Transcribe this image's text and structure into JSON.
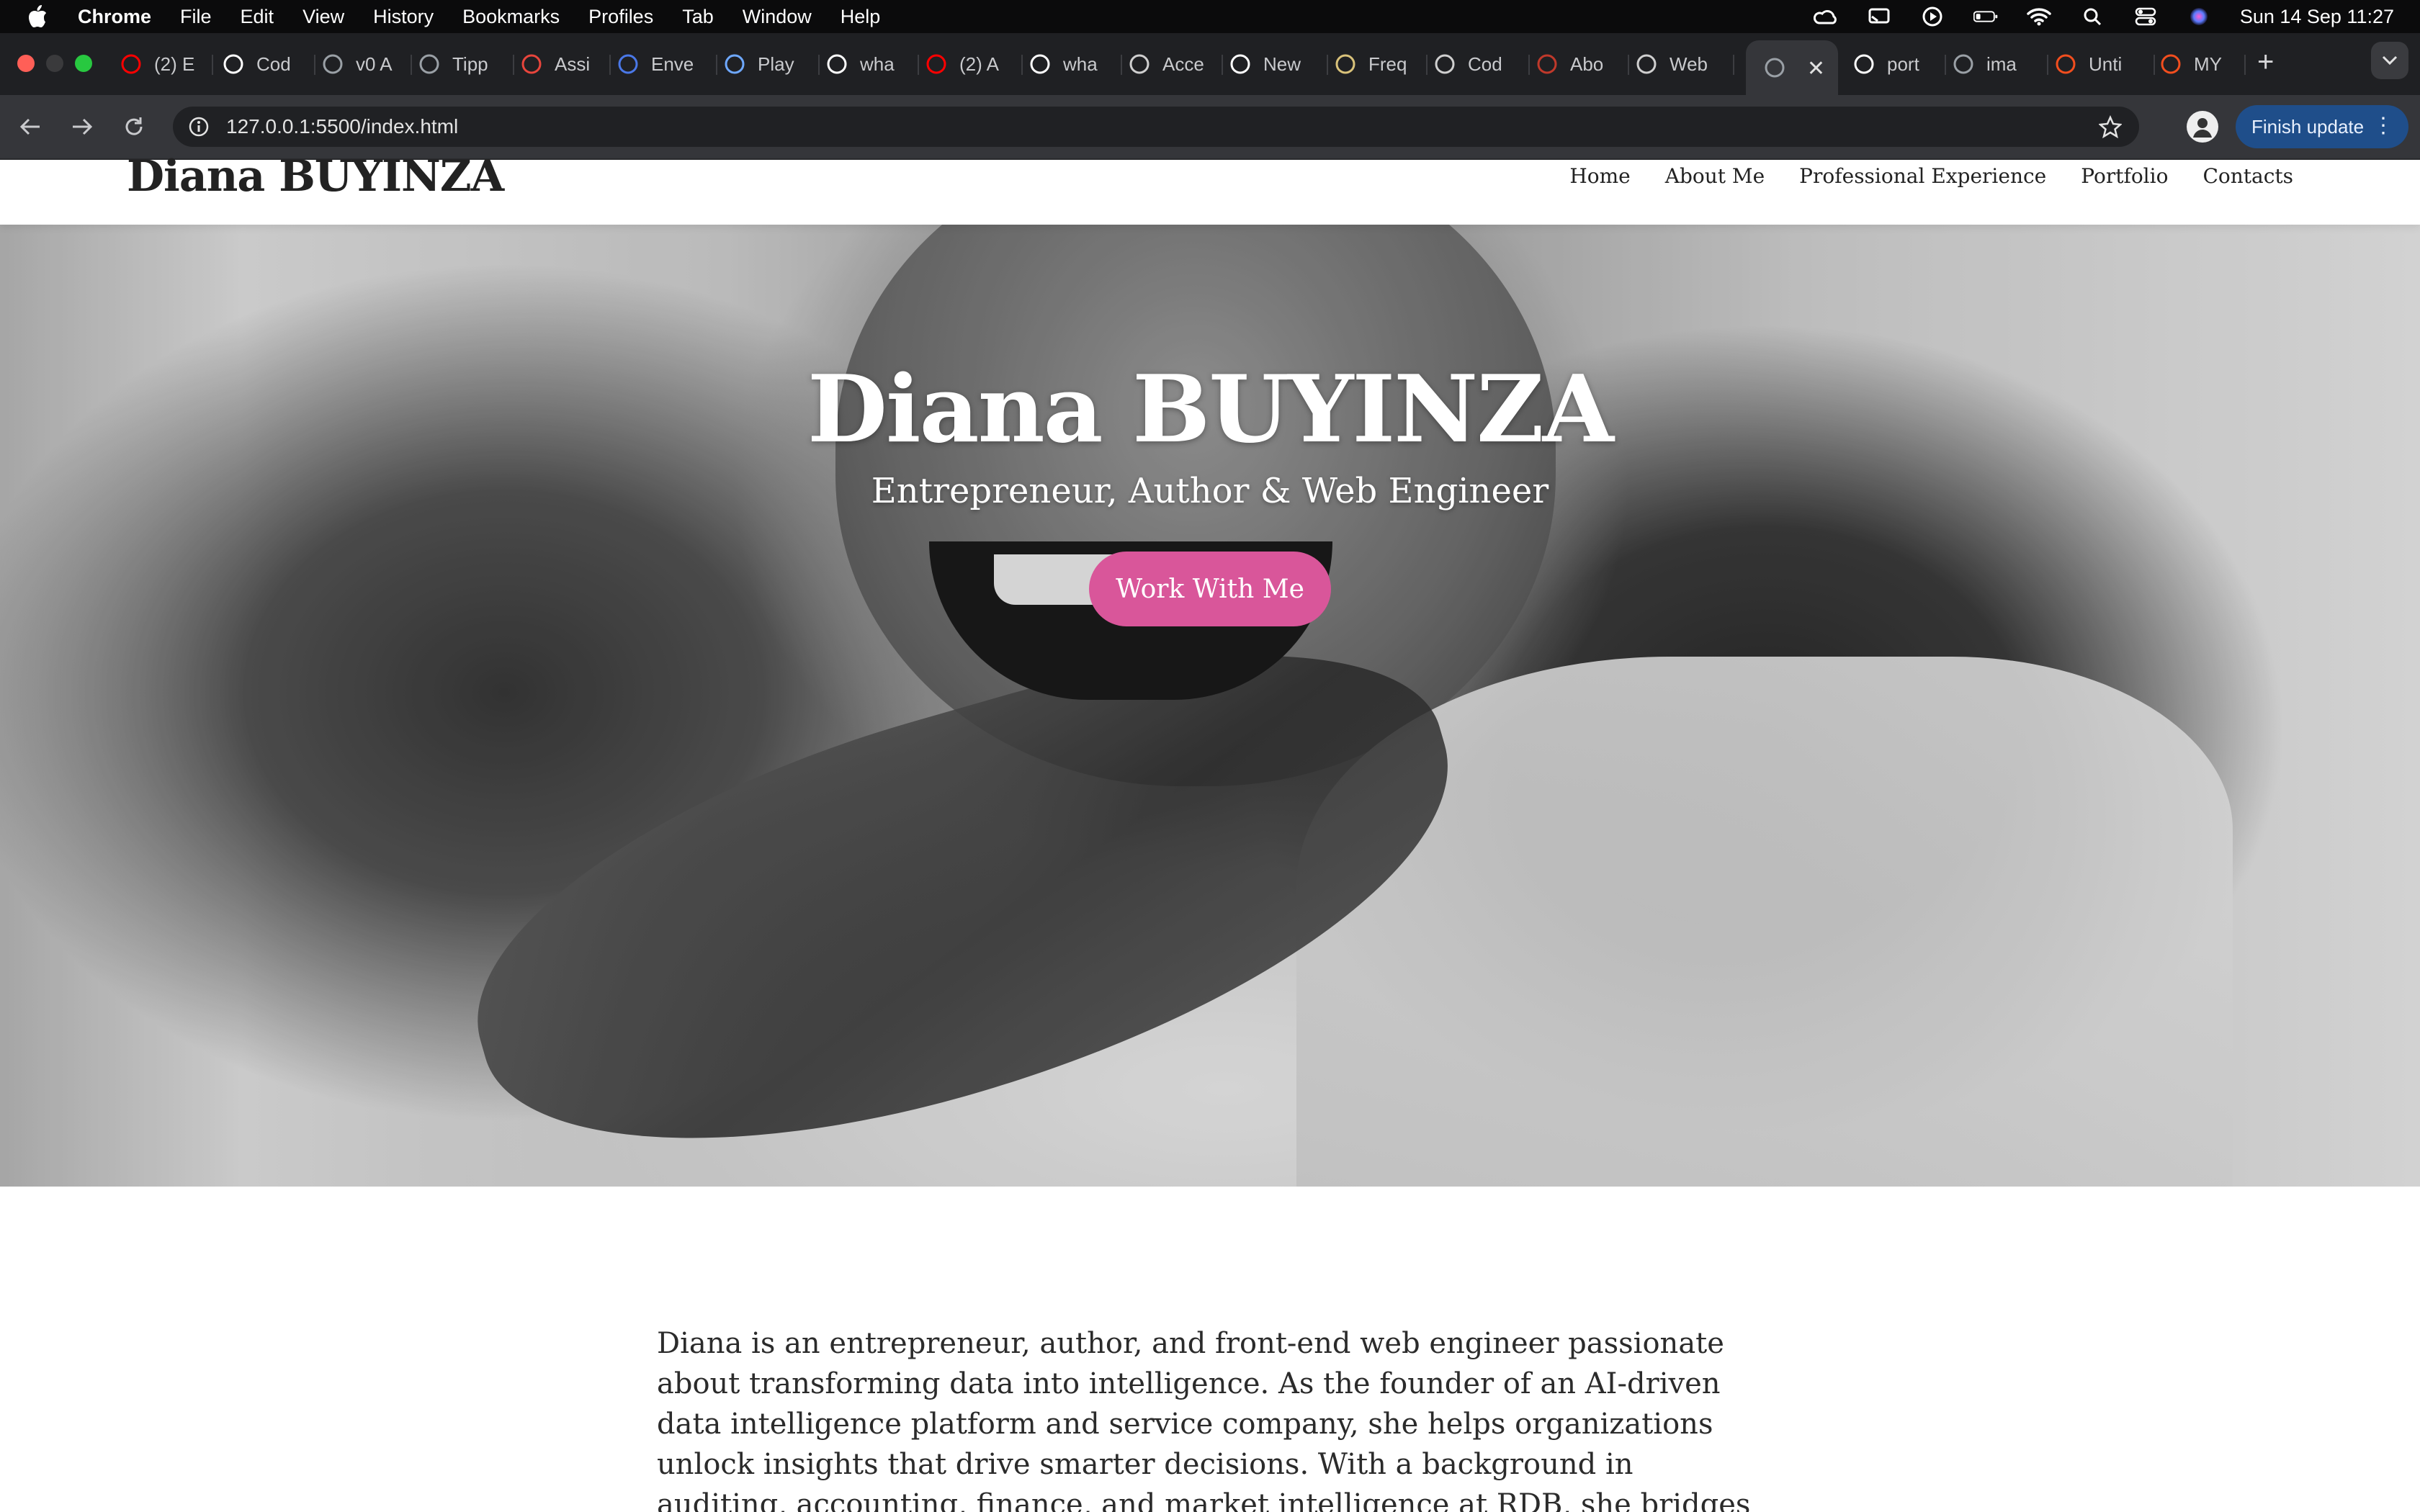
{
  "menubar": {
    "app_name": "Chrome",
    "items": [
      "File",
      "Edit",
      "View",
      "History",
      "Bookmarks",
      "Profiles",
      "Tab",
      "Window",
      "Help"
    ],
    "clock": "Sun 14 Sep  11:27"
  },
  "tabs": [
    {
      "label": "(2) E",
      "icon": "youtube-icon",
      "color": "#ff0000"
    },
    {
      "label": "Cod",
      "icon": "codepen-icon",
      "color": "#ffffff"
    },
    {
      "label": "v0 A",
      "icon": "globe-icon",
      "color": "#9aa0a6"
    },
    {
      "label": "Tipp",
      "icon": "tipp-icon",
      "color": "#9aa0a6"
    },
    {
      "label": "Assi",
      "icon": "assistant-icon",
      "color": "#e8453c"
    },
    {
      "label": "Enve",
      "icon": "flag-icon",
      "color": "#4a78e8"
    },
    {
      "label": "Play",
      "icon": "play-icon",
      "color": "#6ea8ff"
    },
    {
      "label": "wha",
      "icon": "google-icon",
      "color": "#ffffff"
    },
    {
      "label": "(2) A",
      "icon": "youtube-icon",
      "color": "#ff0000"
    },
    {
      "label": "wha",
      "icon": "google-icon",
      "color": "#ffffff"
    },
    {
      "label": "Acce",
      "icon": "plane-icon",
      "color": "#cfcfcf"
    },
    {
      "label": "New",
      "icon": "github-icon",
      "color": "#ffffff"
    },
    {
      "label": "Freq",
      "icon": "badge-icon",
      "color": "#d9c27a"
    },
    {
      "label": "Cod",
      "icon": "openai-icon",
      "color": "#cfcfcf"
    },
    {
      "label": "Abo",
      "icon": "t-icon",
      "color": "#c0392b"
    },
    {
      "label": "Web",
      "icon": "openai-icon",
      "color": "#cfcfcf"
    },
    {
      "label": "",
      "icon": "globe-icon",
      "color": "#9aa0a6",
      "active": true
    },
    {
      "label": "port",
      "icon": "google-icon",
      "color": "#ffffff"
    },
    {
      "label": "ima",
      "icon": "globe-icon",
      "color": "#9aa0a6"
    },
    {
      "label": "Unti",
      "icon": "figma-icon",
      "color": "#f24e1e"
    },
    {
      "label": "MY",
      "icon": "figma-icon",
      "color": "#f24e1e"
    }
  ],
  "toolbar": {
    "url": "127.0.0.1:5500/index.html",
    "update_label": "Finish update"
  },
  "site": {
    "logo": "Diana BUYINZA",
    "nav": [
      "Home",
      "About Me",
      "Professional Experience",
      "Portfolio",
      "Contacts"
    ],
    "hero": {
      "title": "Diana BUYINZA",
      "subtitle": "Entrepreneur, Author & Web Engineer",
      "cta": "Work With Me"
    },
    "about_text": "Diana is an entrepreneur, author, and front-end web engineer passionate about transforming data into intelligence. As the founder of an AI-driven data intelligence platform and service company, she helps organizations unlock insights that drive smarter decisions. With a background in auditing, accounting, finance, and market intelligence at RDB, she bridges business strategy with"
  },
  "colors": {
    "accent": "#d9569a",
    "update_button": "#1f4e8a"
  }
}
